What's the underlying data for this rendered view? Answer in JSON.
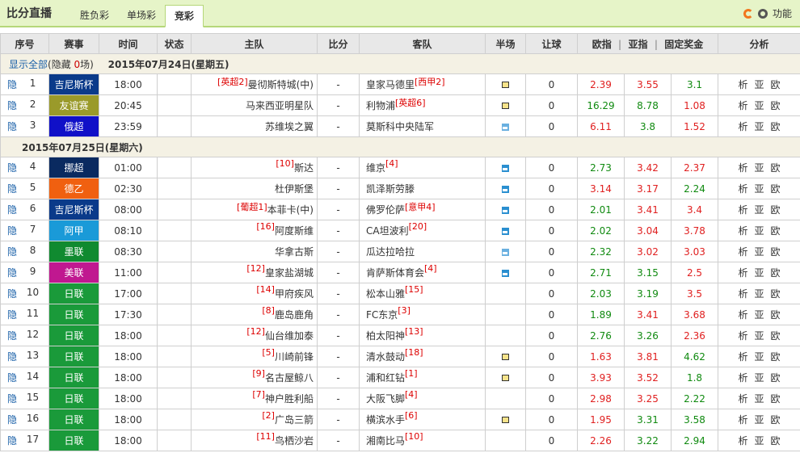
{
  "header": {
    "brand": "比分直播",
    "tabs": [
      {
        "label": "胜负彩",
        "active": false
      },
      {
        "label": "单场彩",
        "active": false
      },
      {
        "label": "竞彩",
        "active": true
      }
    ],
    "function_label": "功能"
  },
  "columns": {
    "seq": "序号",
    "league": "赛事",
    "time": "时间",
    "status": "状态",
    "home": "主队",
    "score": "比分",
    "away": "客队",
    "half": "半场",
    "handicap": "让球",
    "euro": "欧指",
    "asia": "亚指",
    "fixed": "固定奖金",
    "analysis": "分析",
    "sep": "|"
  },
  "section1": {
    "show_all": "显示全部",
    "hidden_prefix": "(隐藏 ",
    "hidden_count": "0",
    "hidden_suffix": "场)",
    "date": "2015年07月24日(星期五)"
  },
  "section2": {
    "date": "2015年07月25日(星期六)"
  },
  "row_common": {
    "hide": "隐",
    "score": "-",
    "handicap": "0",
    "a1": "析",
    "a2": "亚",
    "a3": "欧"
  },
  "matches": [
    {
      "seq": "1",
      "league": "吉尼斯杯",
      "league_color": "#0a3a8a",
      "time": "18:00",
      "home_rank": "[英超2]",
      "home": "曼彻斯特城(中)",
      "away": "皇家马德里",
      "away_rank": "[西甲2]",
      "icon": "tv",
      "o1": "2.39",
      "o2": "3.55",
      "o3": "3.1",
      "c1": "red",
      "c2": "red",
      "c3": "green"
    },
    {
      "seq": "2",
      "league": "友谊赛",
      "league_color": "#9a9a2a",
      "time": "20:45",
      "home_rank": "",
      "home": "马来西亚明星队",
      "away": "利物浦",
      "away_rank": "[英超6]",
      "icon": "tv",
      "o1": "16.29",
      "o2": "8.78",
      "o3": "1.08",
      "c1": "green",
      "c2": "green",
      "c3": "red"
    },
    {
      "seq": "3",
      "league": "俄超",
      "league_color": "#1010c8",
      "time": "23:59",
      "home_rank": "",
      "home": "苏维埃之翼",
      "away": "莫斯科中央陆军",
      "away_rank": "",
      "icon": "blue",
      "o1": "6.11",
      "o2": "3.8",
      "o3": "1.52",
      "c1": "red",
      "c2": "green",
      "c3": "red"
    },
    {
      "seq": "4",
      "league": "挪超",
      "league_color": "#0a2a60",
      "time": "01:00",
      "home_rank": "[10]",
      "home": "斯达",
      "away": "维京",
      "away_rank": "[4]",
      "icon": "chart",
      "o1": "2.73",
      "o2": "3.42",
      "o3": "2.37",
      "c1": "green",
      "c2": "red",
      "c3": "red"
    },
    {
      "seq": "5",
      "league": "德乙",
      "league_color": "#f06010",
      "time": "02:30",
      "home_rank": "",
      "home": "杜伊斯堡",
      "away": "凯泽斯劳滕",
      "away_rank": "",
      "icon": "chart",
      "o1": "3.14",
      "o2": "3.17",
      "o3": "2.24",
      "c1": "red",
      "c2": "red",
      "c3": "green"
    },
    {
      "seq": "6",
      "league": "吉尼斯杯",
      "league_color": "#0a3a8a",
      "time": "08:00",
      "home_rank": "[葡超1]",
      "home": "本菲卡(中)",
      "away": "佛罗伦萨",
      "away_rank": "[意甲4]",
      "icon": "chart",
      "o1": "2.01",
      "o2": "3.41",
      "o3": "3.4",
      "c1": "green",
      "c2": "red",
      "c3": "red"
    },
    {
      "seq": "7",
      "league": "阿甲",
      "league_color": "#1a9ad8",
      "time": "08:10",
      "home_rank": "[16]",
      "home": "阿度斯维",
      "away": "CA坦波利",
      "away_rank": "[20]",
      "icon": "chart",
      "o1": "2.02",
      "o2": "3.04",
      "o3": "3.78",
      "c1": "green",
      "c2": "red",
      "c3": "red"
    },
    {
      "seq": "8",
      "league": "墨联",
      "league_color": "#108a30",
      "time": "08:30",
      "home_rank": "",
      "home": "华拿古斯",
      "away": "瓜达拉哈拉",
      "away_rank": "",
      "icon": "blue",
      "o1": "2.32",
      "o2": "3.02",
      "o3": "3.03",
      "c1": "green",
      "c2": "red",
      "c3": "red"
    },
    {
      "seq": "9",
      "league": "美联",
      "league_color": "#c01890",
      "time": "11:00",
      "home_rank": "[12]",
      "home": "皇家盐湖城",
      "away": "肯萨斯体育会",
      "away_rank": "[4]",
      "icon": "chart",
      "o1": "2.71",
      "o2": "3.15",
      "o3": "2.5",
      "c1": "green",
      "c2": "green",
      "c3": "red"
    },
    {
      "seq": "10",
      "league": "日联",
      "league_color": "#1a9a3a",
      "time": "17:00",
      "home_rank": "[14]",
      "home": "甲府疾风",
      "away": "松本山雅",
      "away_rank": "[15]",
      "icon": "",
      "o1": "2.03",
      "o2": "3.19",
      "o3": "3.5",
      "c1": "green",
      "c2": "green",
      "c3": "red"
    },
    {
      "seq": "11",
      "league": "日联",
      "league_color": "#1a9a3a",
      "time": "17:30",
      "home_rank": "[8]",
      "home": "鹿岛鹿角",
      "away": "FC东京",
      "away_rank": "[3]",
      "icon": "",
      "o1": "1.89",
      "o2": "3.41",
      "o3": "3.68",
      "c1": "green",
      "c2": "red",
      "c3": "red"
    },
    {
      "seq": "12",
      "league": "日联",
      "league_color": "#1a9a3a",
      "time": "18:00",
      "home_rank": "[12]",
      "home": "仙台维加泰",
      "away": "柏太阳神",
      "away_rank": "[13]",
      "icon": "",
      "o1": "2.76",
      "o2": "3.26",
      "o3": "2.36",
      "c1": "green",
      "c2": "green",
      "c3": "red"
    },
    {
      "seq": "13",
      "league": "日联",
      "league_color": "#1a9a3a",
      "time": "18:00",
      "home_rank": "[5]",
      "home": "川崎前锋",
      "away": "清水鼓动",
      "away_rank": "[18]",
      "icon": "tv",
      "o1": "1.63",
      "o2": "3.81",
      "o3": "4.62",
      "c1": "red",
      "c2": "red",
      "c3": "green"
    },
    {
      "seq": "14",
      "league": "日联",
      "league_color": "#1a9a3a",
      "time": "18:00",
      "home_rank": "[9]",
      "home": "名古屋鲸八",
      "away": "浦和红钻",
      "away_rank": "[1]",
      "icon": "tv",
      "o1": "3.93",
      "o2": "3.52",
      "o3": "1.8",
      "c1": "red",
      "c2": "red",
      "c3": "green"
    },
    {
      "seq": "15",
      "league": "日联",
      "league_color": "#1a9a3a",
      "time": "18:00",
      "home_rank": "[7]",
      "home": "神户胜利船",
      "away": "大阪飞脚",
      "away_rank": "[4]",
      "icon": "",
      "o1": "2.98",
      "o2": "3.25",
      "o3": "2.22",
      "c1": "red",
      "c2": "red",
      "c3": "green"
    },
    {
      "seq": "16",
      "league": "日联",
      "league_color": "#1a9a3a",
      "time": "18:00",
      "home_rank": "[2]",
      "home": "广岛三箭",
      "away": "横滨水手",
      "away_rank": "[6]",
      "icon": "tv",
      "o1": "1.95",
      "o2": "3.31",
      "o3": "3.58",
      "c1": "red",
      "c2": "green",
      "c3": "green"
    },
    {
      "seq": "17",
      "league": "日联",
      "league_color": "#1a9a3a",
      "time": "18:00",
      "home_rank": "[11]",
      "home": "鸟栖沙岩",
      "away": "湘南比马",
      "away_rank": "[10]",
      "icon": "",
      "o1": "2.26",
      "o2": "3.22",
      "o3": "2.94",
      "c1": "red",
      "c2": "green",
      "c3": "green"
    }
  ]
}
